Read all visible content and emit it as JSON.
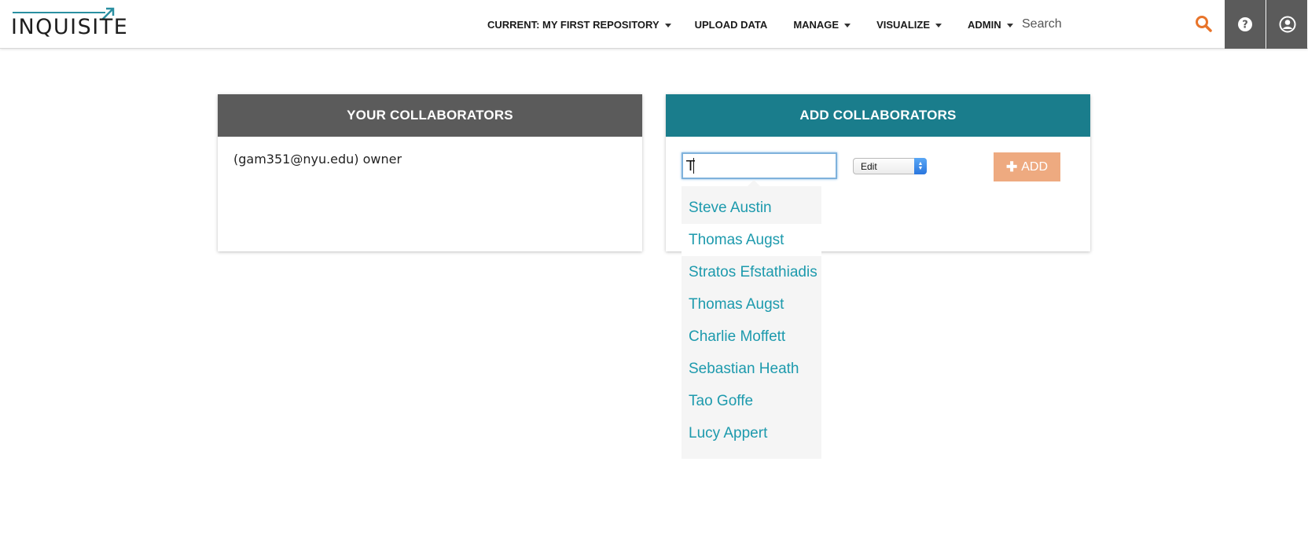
{
  "logo": {
    "text": "INQUISITE"
  },
  "nav": {
    "current_repo": "CURRENT: MY FIRST REPOSITORY",
    "upload": "UPLOAD DATA",
    "manage": "MANAGE",
    "visualize": "VISUALIZE",
    "admin": "ADMIN"
  },
  "search": {
    "placeholder": "Search",
    "value": ""
  },
  "your_collaborators": {
    "title": "YOUR COLLABORATORS",
    "owner_line": "(gam351@nyu.edu) owner"
  },
  "add_collaborators": {
    "title": "ADD COLLABORATORS",
    "input_value": "T",
    "role_selected": "Edit",
    "add_label": "ADD"
  },
  "suggestions": [
    "Steve Austin",
    "Thomas Augst",
    "Stratos Efstathiadis",
    "Thomas Augst",
    "Charlie Moffett",
    "Sebastian Heath",
    "Tao Goffe",
    "Lucy Appert"
  ],
  "colors": {
    "accent_teal": "#1a7d8c",
    "header_gray": "#5b5b5b",
    "link_teal": "#1d9aad",
    "add_button": "#eeaa80",
    "search_icon": "#e8742a"
  },
  "icons": {
    "search": "search-icon",
    "help": "question-circle-icon",
    "user": "user-circle-icon"
  }
}
